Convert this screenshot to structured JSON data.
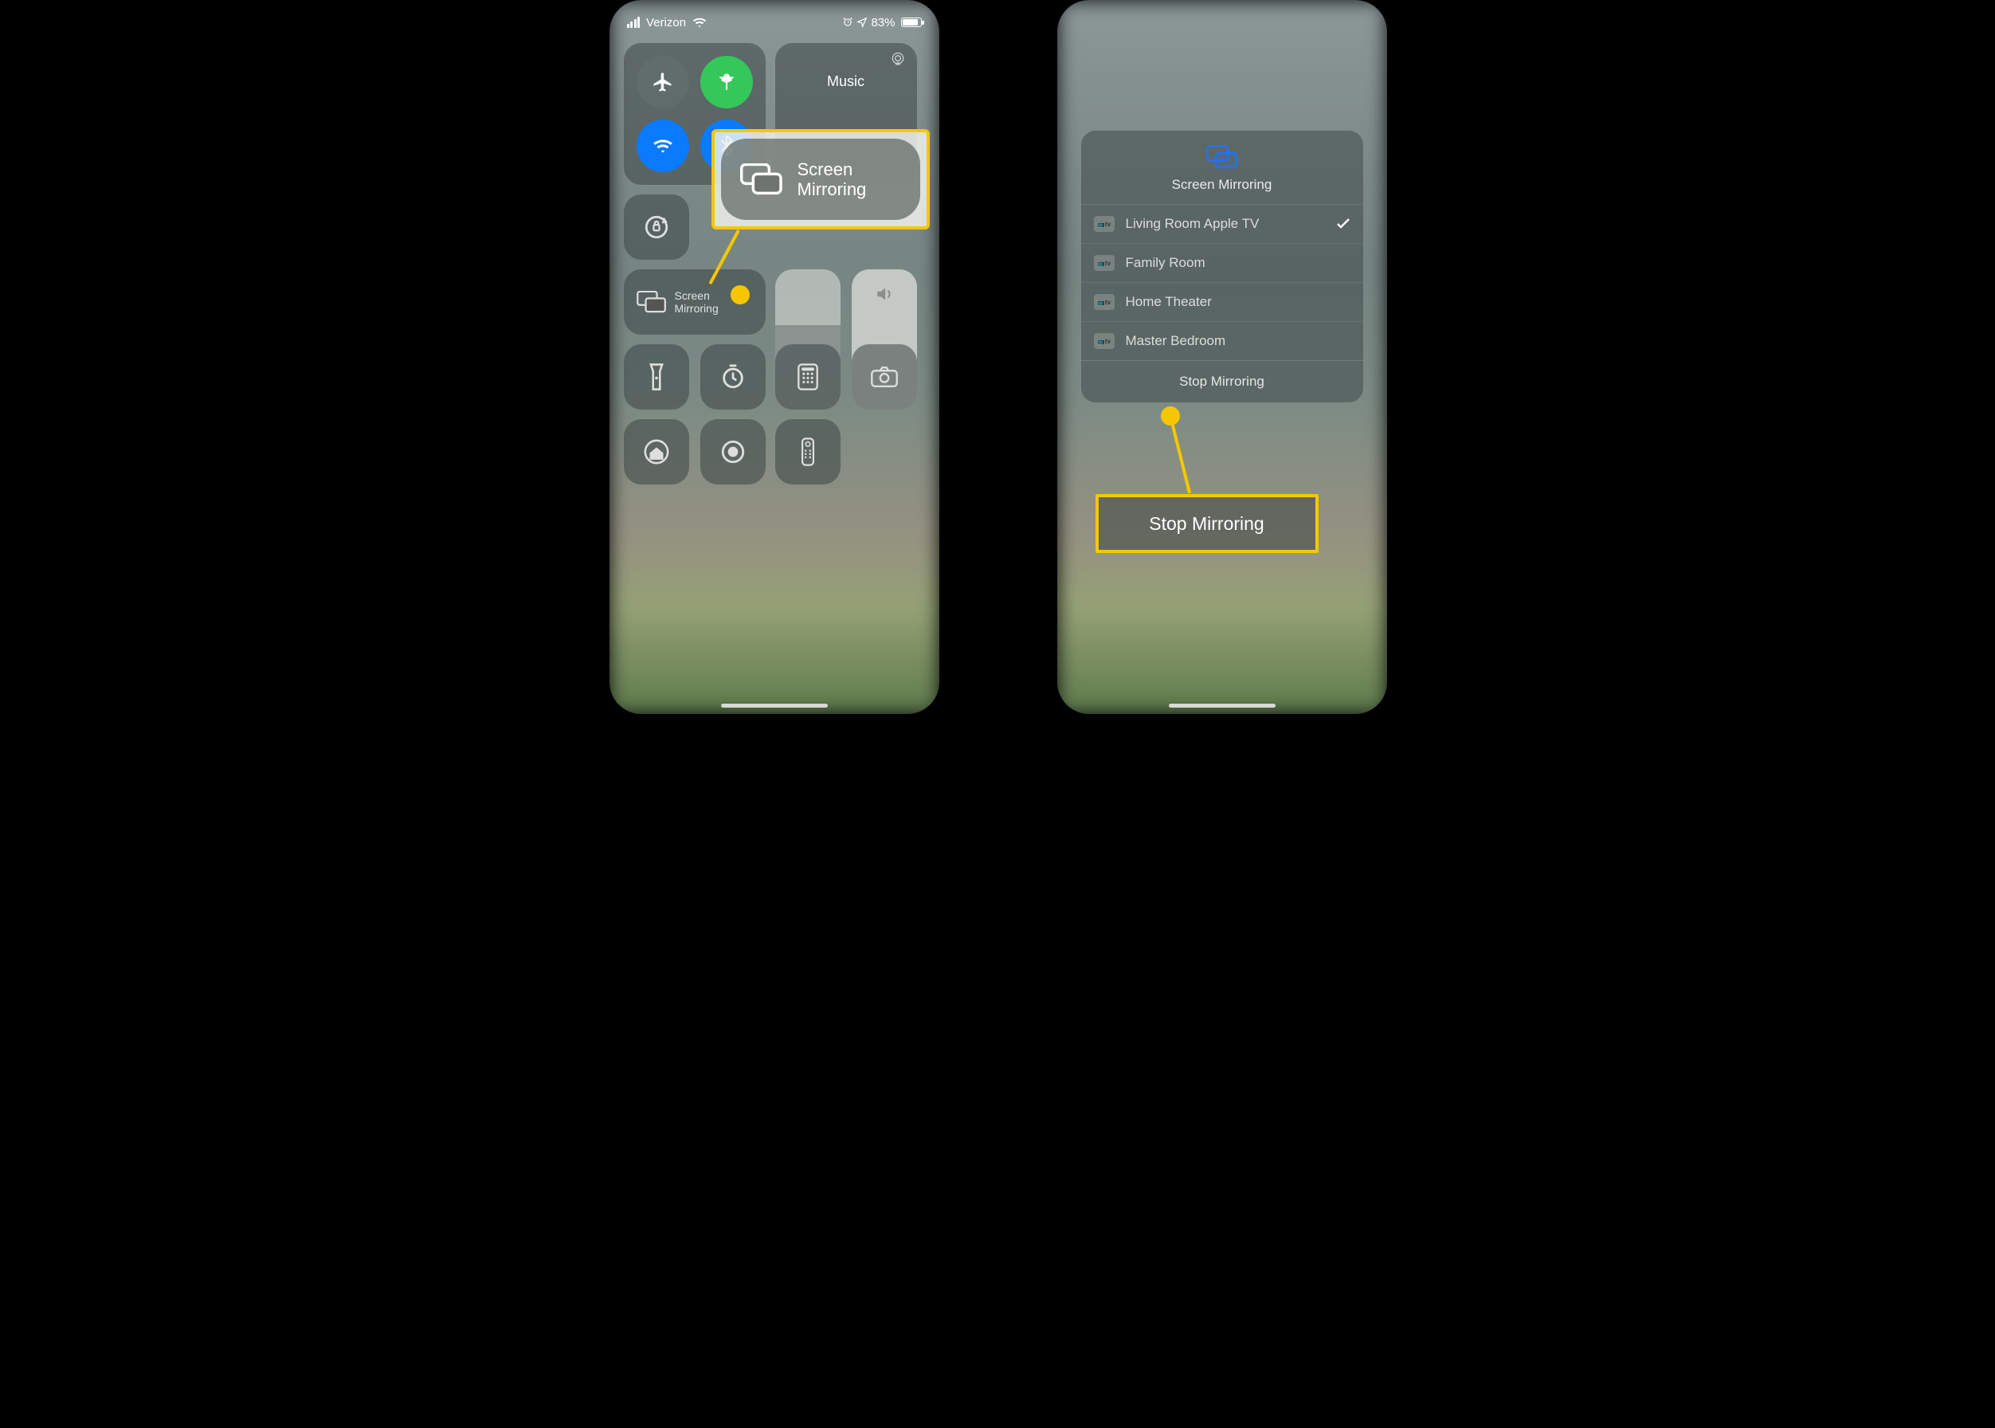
{
  "status": {
    "carrier": "Verizon",
    "battery_pct": "83%",
    "battery_fill_pct": 83
  },
  "cc": {
    "music_label": "Music",
    "mirror_label": "Screen\nMirroring"
  },
  "callout_left": {
    "label": "Screen\nMirroring"
  },
  "sheet": {
    "title": "Screen Mirroring",
    "devices": [
      {
        "name": "Living Room Apple TV",
        "selected": true
      },
      {
        "name": "Family Room",
        "selected": false
      },
      {
        "name": "Home Theater",
        "selected": false
      },
      {
        "name": "Master Bedroom",
        "selected": false
      }
    ],
    "stop_label": "Stop Mirroring"
  },
  "callout_right": {
    "label": "Stop Mirroring"
  }
}
